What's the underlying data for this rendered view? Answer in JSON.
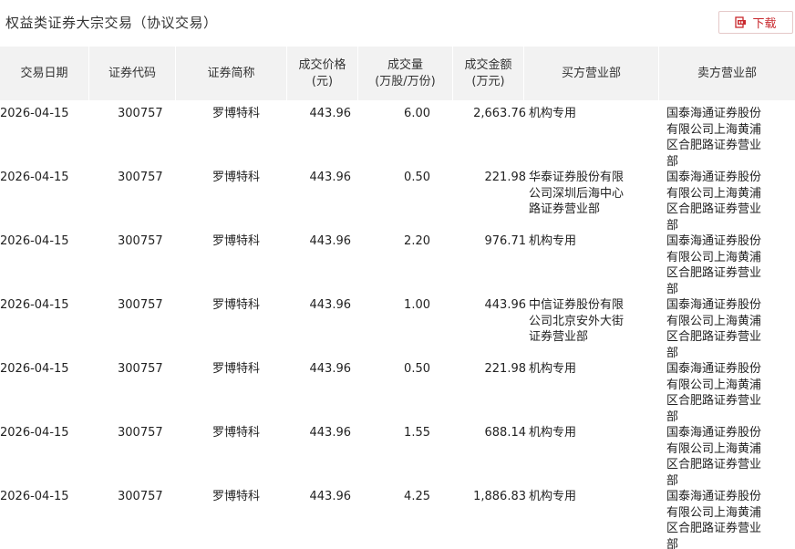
{
  "page": {
    "title": "权益类证券大宗交易（协议交易）",
    "download_label": "下载",
    "accent_color": "#c8282d"
  },
  "table": {
    "columns": [
      {
        "label": "交易日期"
      },
      {
        "label": "证券代码"
      },
      {
        "label": "证券简称"
      },
      {
        "label": "成交价格\n(元)"
      },
      {
        "label": "成交量\n(万股/万份)"
      },
      {
        "label": "成交金额\n(万元)"
      },
      {
        "label": "买方营业部"
      },
      {
        "label": "卖方营业部"
      }
    ],
    "rows": [
      {
        "date": "2026-04-15",
        "code": "300757",
        "name": "罗博特科",
        "price": "443.96",
        "volume": "6.00",
        "amount": "2,663.76",
        "buyer": "机构专用",
        "seller": "国泰海通证券股份有限公司上海黄浦区合肥路证券营业部"
      },
      {
        "date": "2026-04-15",
        "code": "300757",
        "name": "罗博特科",
        "price": "443.96",
        "volume": "0.50",
        "amount": "221.98",
        "buyer": "华泰证券股份有限公司深圳后海中心路证券营业部",
        "seller": "国泰海通证券股份有限公司上海黄浦区合肥路证券营业部"
      },
      {
        "date": "2026-04-15",
        "code": "300757",
        "name": "罗博特科",
        "price": "443.96",
        "volume": "2.20",
        "amount": "976.71",
        "buyer": "机构专用",
        "seller": "国泰海通证券股份有限公司上海黄浦区合肥路证券营业部"
      },
      {
        "date": "2026-04-15",
        "code": "300757",
        "name": "罗博特科",
        "price": "443.96",
        "volume": "1.00",
        "amount": "443.96",
        "buyer": "中信证券股份有限公司北京安外大街证券营业部",
        "seller": "国泰海通证券股份有限公司上海黄浦区合肥路证券营业部"
      },
      {
        "date": "2026-04-15",
        "code": "300757",
        "name": "罗博特科",
        "price": "443.96",
        "volume": "0.50",
        "amount": "221.98",
        "buyer": "机构专用",
        "seller": "国泰海通证券股份有限公司上海黄浦区合肥路证券营业部"
      },
      {
        "date": "2026-04-15",
        "code": "300757",
        "name": "罗博特科",
        "price": "443.96",
        "volume": "1.55",
        "amount": "688.14",
        "buyer": "机构专用",
        "seller": "国泰海通证券股份有限公司上海黄浦区合肥路证券营业部"
      },
      {
        "date": "2026-04-15",
        "code": "300757",
        "name": "罗博特科",
        "price": "443.96",
        "volume": "4.25",
        "amount": "1,886.83",
        "buyer": "机构专用",
        "seller": "国泰海通证券股份有限公司上海黄浦区合肥路证券营业部"
      }
    ]
  }
}
